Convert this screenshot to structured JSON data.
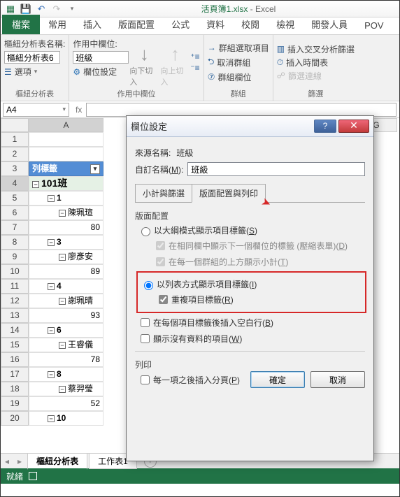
{
  "qat": {
    "title_file": "活頁簿1.xlsx",
    "title_app": "Excel"
  },
  "ribbon_tabs": {
    "file": "檔案",
    "home": "常用",
    "insert": "插入",
    "layout": "版面配置",
    "formulas": "公式",
    "data": "資料",
    "review": "校閱",
    "view": "檢視",
    "developer": "開發人員",
    "powerpivot": "POV"
  },
  "ribbon": {
    "pt_name_label": "樞紐分析表名稱:",
    "pt_name_value": "樞紐分析表6",
    "options": "選項",
    "active_field_label": "作用中欄位:",
    "active_field_value": "班級",
    "field_settings": "欄位設定",
    "drill_down": "向下切入",
    "drill_up": "向上切入",
    "group_select": "群組選取項目",
    "ungroup": "取消群組",
    "group_field": "群組欄位",
    "slicer": "插入交叉分析篩選",
    "timeline": "插入時間表",
    "filter_conn": "篩選連線",
    "g_pivottable": "樞紐分析表",
    "g_activefield": "作用中欄位",
    "g_group": "群組",
    "g_filter": "篩選"
  },
  "namebox": "A4",
  "columns": {
    "A": "A",
    "G": "G"
  },
  "cells": {
    "header": "列標籤",
    "r4": "101班",
    "r5": "1",
    "r6": "陳珮瑄",
    "r7": "80",
    "r8": "3",
    "r9": "廖彥安",
    "r10": "89",
    "r11": "4",
    "r12": "謝珮晴",
    "r13": "93",
    "r14": "6",
    "r15": "王睿儀",
    "r16": "78",
    "r17": "8",
    "r18": "蔡羿瑩",
    "r19": "52",
    "r20": "10"
  },
  "sheettabs": {
    "pivot": "樞紐分析表",
    "sheet1": "工作表1"
  },
  "status": {
    "ready": "就緒"
  },
  "dialog": {
    "title": "欄位設定",
    "src_label": "來源名稱:",
    "src_value": "班級",
    "cust_label": "自訂名稱",
    "cust_key": "M",
    "cust_value": "班級",
    "tab1": "小計與篩選",
    "tab2": "版面配置與列印",
    "sec_layout": "版面配置",
    "opt_outline": "以大綱模式顯示項目標籤",
    "opt_outline_key": "S",
    "sub_same": "在相同欄中顯示下一個欄位的標籤 (壓縮表單)",
    "sub_same_key": "D",
    "sub_subtotals": "在每一個群組的上方顯示小計",
    "sub_subtotals_key": "T",
    "opt_tabular": "以列表方式顯示項目標籤",
    "opt_tabular_key": "I",
    "opt_repeat": "重複項目標籤",
    "opt_repeat_key": "R",
    "opt_blank": "在每個項目標籤後插入空白行",
    "opt_blank_key": "B",
    "opt_noitems": "顯示沒有資料的項目",
    "opt_noitems_key": "W",
    "sec_print": "列印",
    "opt_pagebreak": "每一項之後插入分頁",
    "opt_pagebreak_key": "P",
    "ok": "確定",
    "cancel": "取消"
  }
}
